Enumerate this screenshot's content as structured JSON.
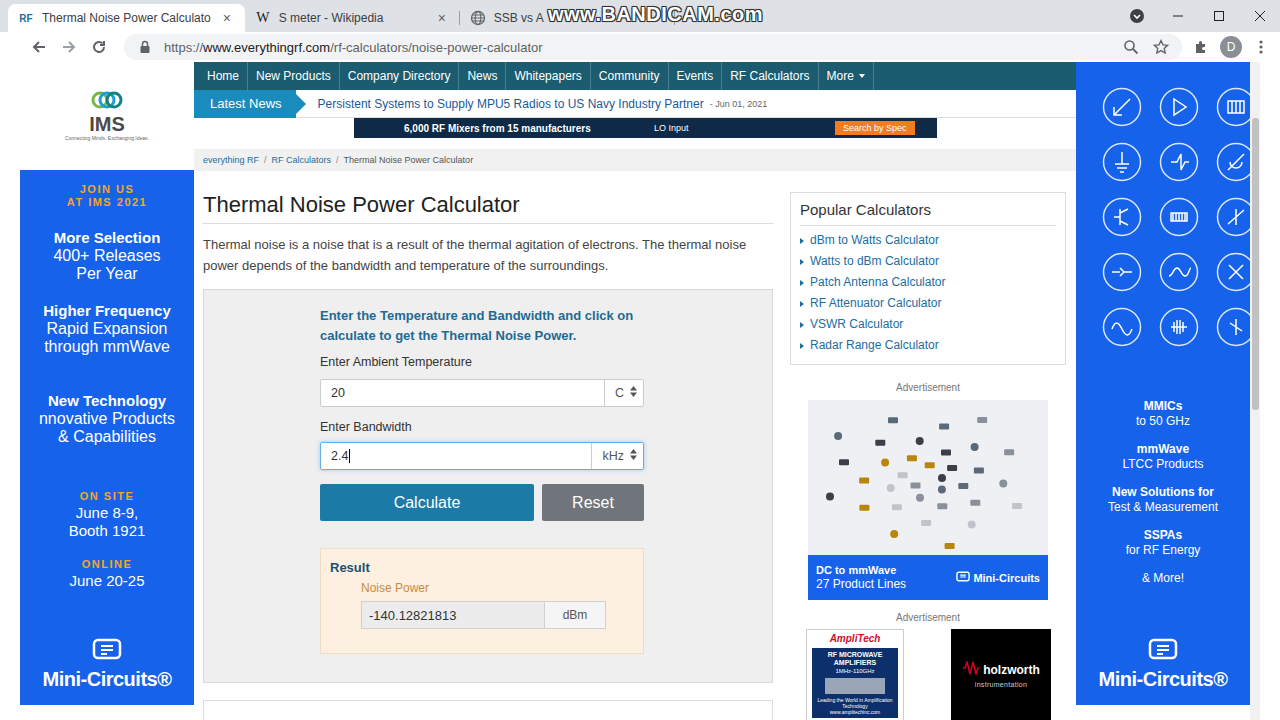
{
  "browser": {
    "tabs": [
      {
        "kind": "text",
        "favicon": "RF",
        "label": "Thermal Noise Power Calculato",
        "close": "×",
        "selected": true
      },
      {
        "kind": "text",
        "favicon": "W",
        "label": "S meter - Wikipedia",
        "close": "×",
        "selected": false
      },
      {
        "kind": "globe",
        "label": "SSB vs A",
        "selected": false
      }
    ],
    "watermark": "www.BANDICAM.com",
    "url_scheme": "https://",
    "url_host": "www.everythingrf.com",
    "url_path": "/rf-calculators/noise-power-calculator",
    "profile": "D"
  },
  "left_ad": {
    "logo": "IMS",
    "tagline": "Connecting Minds. Exchanging Ideas.",
    "groups": [
      {
        "kind": "kicker",
        "lines": [
          "JOIN US",
          "AT IMS 2021"
        ]
      },
      {
        "kind": "feature",
        "lines": [
          "More Selection",
          "400+ Releases",
          "Per Year"
        ]
      },
      {
        "kind": "feature",
        "lines": [
          "Higher  Frequency",
          "Rapid Expansion",
          "through mmWave"
        ]
      },
      {
        "kind": "feature",
        "lines": [
          "New Technology",
          "nnovative  Products",
          "& Capabilities"
        ]
      },
      {
        "kind": "event",
        "lines": [
          "ON SITE",
          "June 8-9,",
          "Booth 1921"
        ]
      },
      {
        "kind": "event",
        "lines": [
          "ONLINE",
          "June 20-25"
        ]
      }
    ],
    "brand": "Mini-Circuits®"
  },
  "nav": {
    "items": [
      {
        "label": "Home",
        "caret": false
      },
      {
        "label": "New Products",
        "caret": false
      },
      {
        "label": "Company Directory",
        "caret": false
      },
      {
        "label": "News",
        "caret": false
      },
      {
        "label": "Whitepapers",
        "caret": false
      },
      {
        "label": "Community",
        "caret": false
      },
      {
        "label": "Events",
        "caret": false
      },
      {
        "label": "RF Calculators",
        "caret": false
      },
      {
        "label": "More",
        "caret": true
      }
    ]
  },
  "news": {
    "label": "Latest News",
    "headline": "Persistent Systems to Supply MPU5 Radios to US Navy Industry Partner",
    "date": "- Jun 01, 2021"
  },
  "banner": {
    "headline": "6,000 RF Mixers from 15 manufacturers",
    "caption": "LO Input",
    "button": "Search by Spec"
  },
  "breadcrumb": {
    "items": [
      "everything RF",
      "RF Calculators",
      "Thermal Noise Power Calculator"
    ],
    "separator": "/"
  },
  "page": {
    "title": "Thermal Noise Power Calculator",
    "description": "Thermal noise is a noise that is a result of the thermal agitation of electrons. The thermal noise power depends of the bandwidth and temperature of the surroundings."
  },
  "calculator": {
    "instruction": "Enter the Temperature and Bandwidth and click on calculate to get the Thermal Noise Power.",
    "fields": [
      {
        "label": "Enter Ambient Temperature",
        "value": "20",
        "unit": "C",
        "focused": false
      },
      {
        "label": "Enter Bandwidth",
        "value": "2.4",
        "unit": "kHz",
        "focused": true
      }
    ],
    "buttons": [
      "Calculate",
      "Reset"
    ],
    "result": {
      "title": "Result",
      "label": "Noise Power",
      "value": "-140.12821813",
      "unit": "dBm"
    }
  },
  "sidebar": {
    "title": "Popular Calculators",
    "items": [
      "dBm to Watts Calculator",
      "Watts to dBm Calculator",
      "Patch Antenna Calculator",
      "RF Attenuator Calculator",
      "VSWR Calculator",
      "Radar Range Calculator"
    ],
    "ad_labels": [
      "Advertisement",
      "Advertisement"
    ]
  },
  "sidebar_ads": {
    "minicircuits": {
      "line1": "DC to mmWave",
      "line2": "27 Product Lines",
      "brand": "Mini-Circuits"
    },
    "amplitech": {
      "logo": "AmpliTech",
      "heading": "RF MICROWAVE AMPLIFIERS",
      "range": "1MHz-110GHz",
      "note": "Leading the World in Amplification Technology",
      "site": "www.amplitechinc.com"
    },
    "holzworth": {
      "name": "holzworth",
      "sub": "instrumentation"
    }
  },
  "right_ad": {
    "groups": [
      {
        "kind": "feature",
        "lines": [
          "MMICs",
          "to 50 GHz"
        ]
      },
      {
        "kind": "feature",
        "lines": [
          "mmWave",
          "LTCC Products"
        ]
      },
      {
        "kind": "feature",
        "lines": [
          "New Solutions for",
          "Test & Measurement"
        ]
      },
      {
        "kind": "feature",
        "lines": [
          "SSPAs",
          "for RF Energy"
        ]
      },
      {
        "kind": "plain",
        "lines": [
          "& More!"
        ]
      }
    ],
    "brand": "Mini-Circuits®"
  }
}
